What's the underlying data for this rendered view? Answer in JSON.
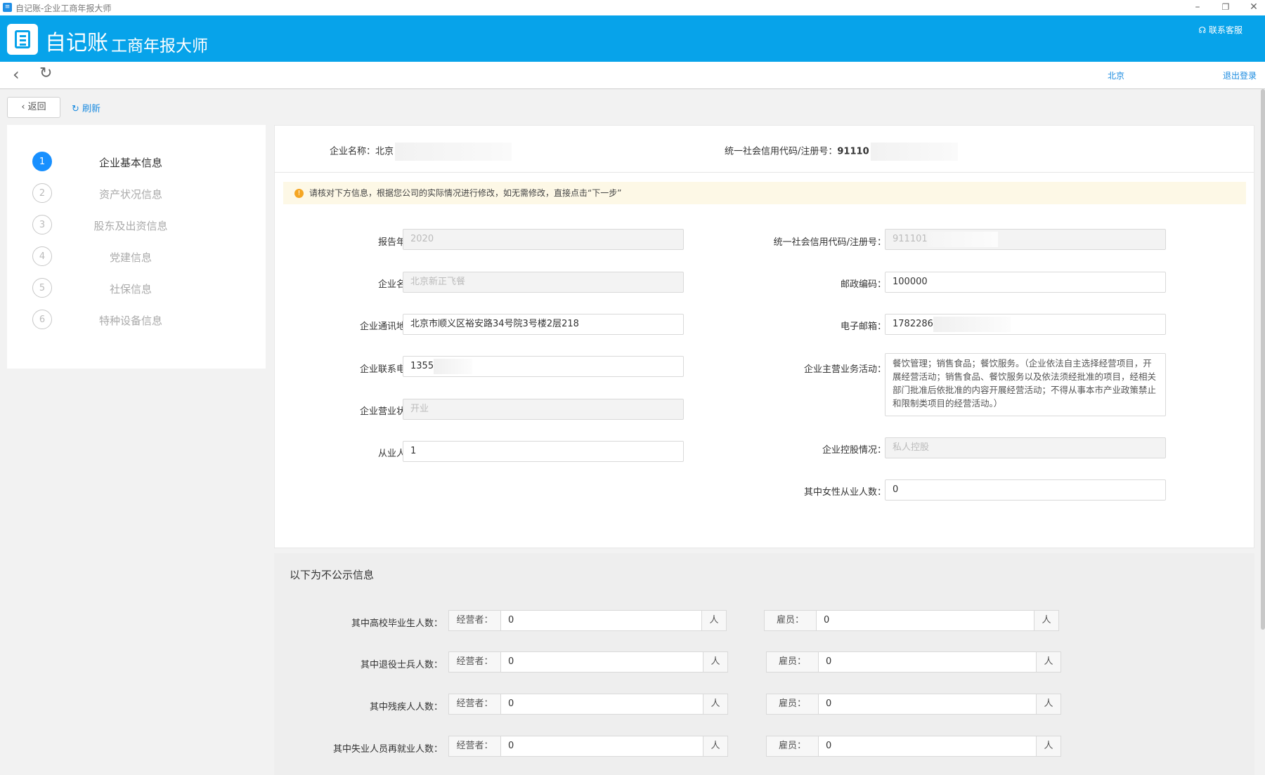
{
  "window": {
    "title": "自记账-企业工商年报大师",
    "minimize_icon": "–",
    "restore_icon": "❐",
    "close_icon": "✕"
  },
  "header": {
    "brand": "自记账",
    "product": "工商年报大师",
    "contact": "联系客服"
  },
  "navbar": {
    "city": "北京",
    "logout": "退出登录"
  },
  "actions": {
    "return": "返回",
    "refresh": "刷新"
  },
  "steps": [
    {
      "num": "1",
      "label": "企业基本信息",
      "active": true
    },
    {
      "num": "2",
      "label": "资产状况信息"
    },
    {
      "num": "3",
      "label": "股东及出资信息"
    },
    {
      "num": "4",
      "label": "党建信息"
    },
    {
      "num": "5",
      "label": "社保信息"
    },
    {
      "num": "6",
      "label": "特种设备信息"
    }
  ],
  "topinfo": {
    "name_label": "企业名称：",
    "name_value": "北京",
    "code_label": "统一社会信用代码/注册号：",
    "code_value": "91110"
  },
  "notice": "请核对下方信息，根据您公司的实际情况进行修改，如无需修改，直接点击“下一步”",
  "form": {
    "year": {
      "label": "报告年度：",
      "value": "2020"
    },
    "credit": {
      "label": "统一社会信用代码/注册号：",
      "value": "911101"
    },
    "company": {
      "label": "企业名称：",
      "value": "北京新正飞餐"
    },
    "postcode": {
      "label": "邮政编码：",
      "value": "100000"
    },
    "address": {
      "label": "企业通讯地址：",
      "value": "北京市顺义区裕安路34号院3号楼2层218"
    },
    "email": {
      "label": "电子邮箱：",
      "value": "1782286"
    },
    "phone": {
      "label": "企业联系电话：",
      "value": "1355"
    },
    "business": {
      "label": "企业主营业务活动：",
      "value": "餐饮管理；销售食品；餐饮服务。（企业依法自主选择经营项目，开展经营活动；销售食品、餐饮服务以及依法须经批准的项目，经相关部门批准后依批准的内容开展经营活动；不得从事本市产业政策禁止和限制类项目的经营活动。）"
    },
    "status": {
      "label": "企业营业状态：",
      "value": "开业"
    },
    "control": {
      "label": "企业控股情况：",
      "value": "私人控股"
    },
    "employees": {
      "label": "从业人数：",
      "value": "1"
    },
    "female": {
      "label": "其中女性从业人数：",
      "value": "0"
    }
  },
  "private": {
    "title": "以下为不公示信息",
    "operator_label": "经营者：",
    "employee_label": "雇员：",
    "unit": "人",
    "rows": [
      {
        "label": "其中高校毕业生人数：",
        "operator": "0",
        "employee": "0"
      },
      {
        "label": "其中退役士兵人数：",
        "operator": "0",
        "employee": "0"
      },
      {
        "label": "其中残疾人人数：",
        "operator": "0",
        "employee": "0"
      },
      {
        "label": "其中失业人员再就业人数：",
        "operator": "0",
        "employee": "0"
      }
    ]
  }
}
